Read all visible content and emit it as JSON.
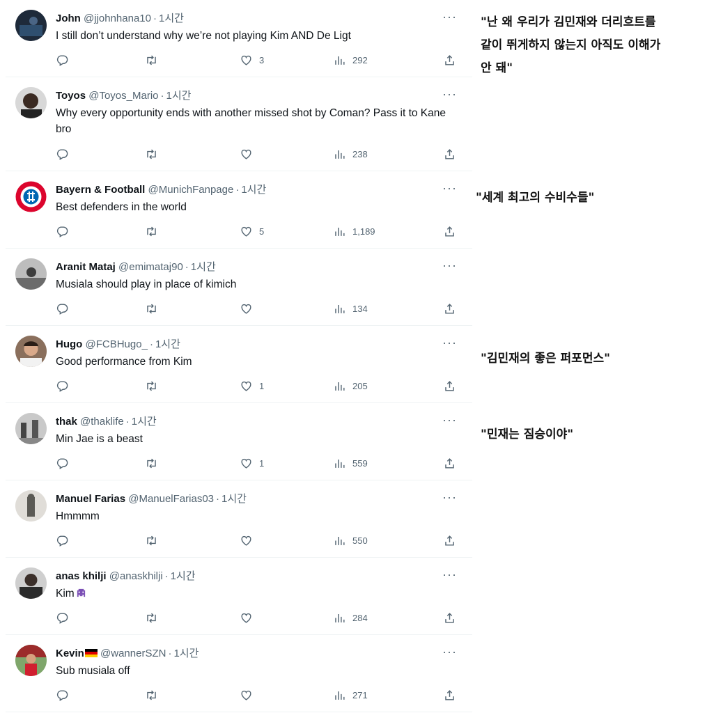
{
  "tweets": [
    {
      "name": "John",
      "handle": "@jjohnhana10",
      "time": "1시간",
      "text": "I still don’t understand why we’re not playing Kim AND De Ligt",
      "likes": "3",
      "views": "292"
    },
    {
      "name": "Toyos",
      "handle": "@Toyos_Mario",
      "time": "1시간",
      "text": "Why every opportunity ends with another missed shot by Coman? Pass it to Kane bro",
      "likes": "",
      "views": "238"
    },
    {
      "name": "Bayern & Football",
      "handle": "@MunichFanpage",
      "time": "1시간",
      "text": "Best defenders in the world",
      "likes": "5",
      "views": "1,189"
    },
    {
      "name": "Aranit Mataj",
      "handle": "@emimataj90",
      "time": "1시간",
      "text": "Musiala should play in place of kimich",
      "likes": "",
      "views": "134"
    },
    {
      "name": "Hugo",
      "handle": "@FCBHugo_",
      "time": "1시간",
      "text": "Good performance from Kim",
      "likes": "1",
      "views": "205"
    },
    {
      "name": "thak",
      "handle": "@thaklife",
      "time": "1시간",
      "text": "Min Jae is a beast",
      "likes": "1",
      "views": "559"
    },
    {
      "name": "Manuel Farias",
      "handle": "@ManuelFarias03",
      "time": "1시간",
      "text": "Hmmmm",
      "likes": "",
      "views": "550"
    },
    {
      "name": "anas khilji",
      "handle": "@anaskhilji",
      "time": "1시간",
      "text": "Kim",
      "likes": "",
      "views": "284"
    },
    {
      "name": "Kevin",
      "handle": "@wannerSZN",
      "time": "1시간",
      "text": "Sub musiala off",
      "likes": "",
      "views": "271"
    }
  ],
  "ui": {
    "dot": "·",
    "more": "···"
  },
  "captions": {
    "c1_line1": "\"난 왜 우리가 김민재와 더리흐트를",
    "c1_line2": "같이 뛰게하지 않는지 아직도 이해가",
    "c1_line3": "안 돼\"",
    "c2": "\"세계 최고의 수비수들\"",
    "c3": "\"김민재의 좋은 퍼포먼스\"",
    "c4": "\"민재는 짐승이야\""
  },
  "colors": {
    "text": "#0f1419",
    "secondary": "#536471",
    "divider": "#eff3f4"
  },
  "icons": [
    "reply-icon",
    "retweet-icon",
    "like-icon",
    "views-icon",
    "share-icon",
    "more-icon"
  ]
}
